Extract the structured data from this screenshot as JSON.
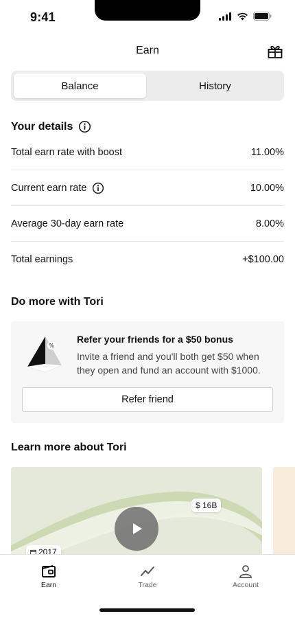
{
  "status": {
    "time": "9:41"
  },
  "header": {
    "title": "Earn"
  },
  "segments": {
    "active": "Balance",
    "inactive": "History"
  },
  "details": {
    "title": "Your details",
    "rows": [
      {
        "label": "Total earn rate with boost",
        "value": "11.00%"
      },
      {
        "label": "Current earn rate",
        "value": "10.00%"
      },
      {
        "label": "Average 30-day earn rate",
        "value": "8.00%"
      },
      {
        "label": "Total earnings",
        "value": "+$100.00"
      }
    ]
  },
  "more": {
    "title": "Do more with Tori",
    "promo_title": "Refer your friends for a $50 bonus",
    "promo_desc": "Invite a friend and you'll both get $50 when they open and fund an account with $1000.",
    "button": "Refer friend"
  },
  "learn": {
    "title": "Learn more about Tori",
    "chip_amount": "$ 16B",
    "chip_year": "2017"
  },
  "tabs": {
    "earn": "Earn",
    "trade": "Trade",
    "account": "Account"
  },
  "colors": {
    "accent": "#111111",
    "card_bg": "#e4e9d9",
    "promo_bg": "#f7f7f7"
  }
}
